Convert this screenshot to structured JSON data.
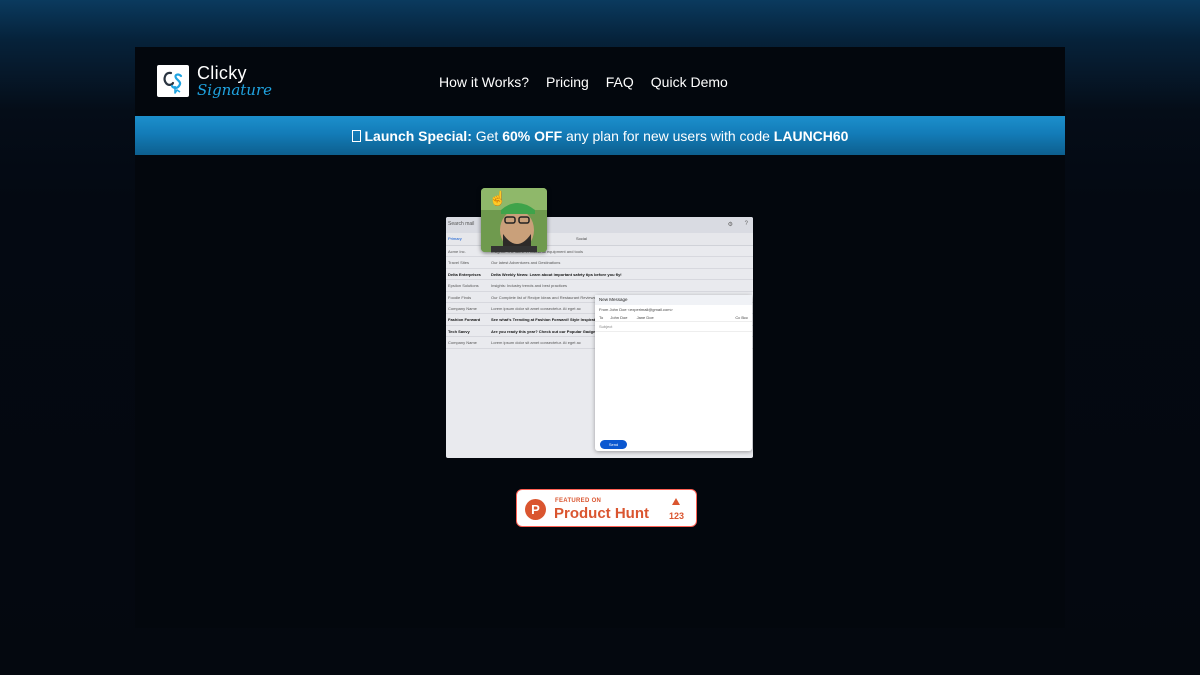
{
  "brand": {
    "word1": "Clicky",
    "word2": "Signature"
  },
  "nav": {
    "items": [
      "How it Works?",
      "Pricing",
      "FAQ",
      "Quick Demo"
    ]
  },
  "banner": {
    "lead": "Launch Special:",
    "text1": " Get ",
    "discount": "60% OFF",
    "text2": " any plan for new users with code ",
    "code": "LAUNCH60",
    "accent_color": "#137cb8"
  },
  "demo": {
    "search": "Search mail",
    "tabs": [
      "Primary",
      "Promotions",
      "Social"
    ],
    "rows": [
      {
        "sender": "Acme Inc.",
        "text": "Insights: The latest in industrial equipment and tools",
        "bold": false
      },
      {
        "sender": "Travel Sites",
        "text": "Our latest Adventures and Destinations",
        "bold": false
      },
      {
        "sender": "Delta Enterprises",
        "text": "Delta Weekly News: Learn about important safety tips before you fly!",
        "bold": true
      },
      {
        "sender": "Epsilon Solutions",
        "text": "Insights: Industry trends and best practices",
        "bold": false
      },
      {
        "sender": "Foodie Finds",
        "text": "Our Complete list of Recipe Ideas and Restaurant Reviews",
        "bold": false
      },
      {
        "sender": "Company Name",
        "text": "Lorem ipsum dolor sit amet consectetur. At eget ac",
        "bold": false
      },
      {
        "sender": "Fashion Forward",
        "text": "See what's Trending at Fashion Forward! Style Inspiration",
        "bold": true
      },
      {
        "sender": "Tech Savvy",
        "text": "Are you ready this year? Check out our Popular Gadgets",
        "bold": true
      },
      {
        "sender": "Company Name",
        "text": "Lorem ipsum dolor sit amet consectetur. At eget ac",
        "bold": false
      }
    ],
    "compose": {
      "title": "New Message",
      "from": "From John Doe <experimail@gmail.com>",
      "to_label": "To",
      "recipients": [
        "John Doe",
        "Jane Doe"
      ],
      "cc": "Cc Bcc",
      "subject": "Subject",
      "send": "Send"
    }
  },
  "product_hunt": {
    "logo": "P",
    "featured": "FEATURED ON",
    "name": "Product Hunt",
    "votes": "123",
    "color": "#da552f"
  }
}
